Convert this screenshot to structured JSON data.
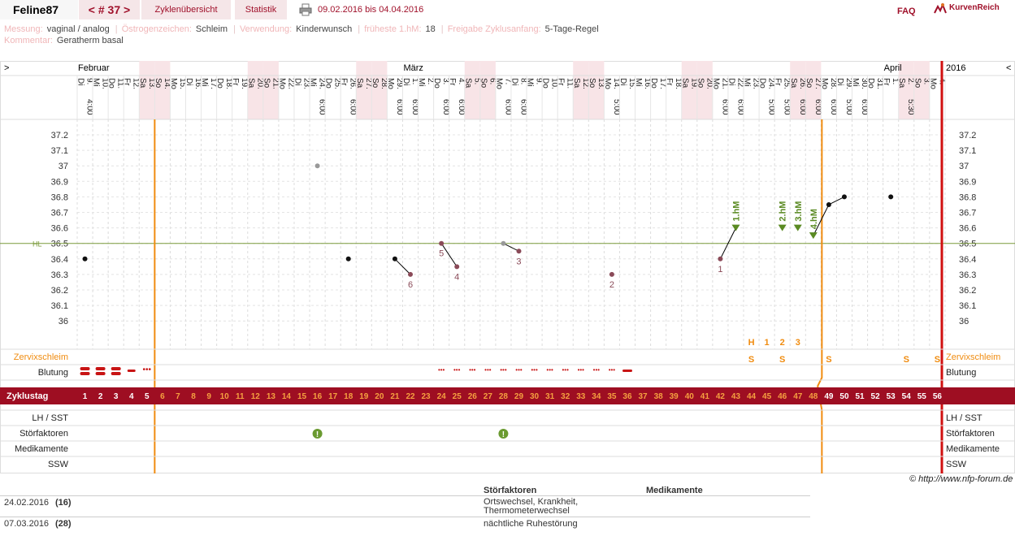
{
  "header": {
    "user": "Feline87",
    "cycle": "< # 37 >",
    "overview": "Zyklenübersicht",
    "stats": "Statistik",
    "range": "09.02.2016 bis 04.04.2016",
    "faq": "FAQ",
    "brand": "KurvenReich"
  },
  "info": {
    "messung_l": "Messung:",
    "messung_v": "vaginal / analog",
    "oestro_l": "Östrogenzeichen:",
    "oestro_v": "Schleim",
    "verw_l": "Verwendung:",
    "verw_v": "Kinderwunsch",
    "hm_l": "früheste 1.hM:",
    "hm_v": "18",
    "frei_l": "Freigabe Zyklusanfang:",
    "frei_v": "5-Tage-Regel",
    "kom_l": "Kommentar:",
    "kom_v": "Geratherm basal"
  },
  "chart": {
    "nav_left": ">",
    "nav_right": "<",
    "year": "2016",
    "months": [
      {
        "name": "Februar",
        "day": 0
      },
      {
        "name": "März",
        "day": 21
      },
      {
        "name": "April",
        "day": 52
      }
    ],
    "days": [
      {
        "d": "9.",
        "w": "Di"
      },
      {
        "d": "10.",
        "w": "Mi"
      },
      {
        "d": "11.",
        "w": "Do"
      },
      {
        "d": "12.",
        "w": "Fr"
      },
      {
        "d": "13.",
        "w": "Sa"
      },
      {
        "d": "14.",
        "w": "So"
      },
      {
        "d": "15.",
        "w": "Mo"
      },
      {
        "d": "16.",
        "w": "Di"
      },
      {
        "d": "17.",
        "w": "Mi"
      },
      {
        "d": "18.",
        "w": "Do"
      },
      {
        "d": "19.",
        "w": "Fr"
      },
      {
        "d": "20.",
        "w": "Sa"
      },
      {
        "d": "21.",
        "w": "So"
      },
      {
        "d": "22.",
        "w": "Mo"
      },
      {
        "d": "23.",
        "w": "Di"
      },
      {
        "d": "24.",
        "w": "Mi"
      },
      {
        "d": "25.",
        "w": "Do"
      },
      {
        "d": "26.",
        "w": "Fr"
      },
      {
        "d": "27.",
        "w": "Sa"
      },
      {
        "d": "28.",
        "w": "So"
      },
      {
        "d": "29.",
        "w": "Mo"
      },
      {
        "d": "1.",
        "w": "Di"
      },
      {
        "d": "2.",
        "w": "Mi"
      },
      {
        "d": "3.",
        "w": "Do"
      },
      {
        "d": "4.",
        "w": "Fr"
      },
      {
        "d": "5.",
        "w": "Sa"
      },
      {
        "d": "6.",
        "w": "So"
      },
      {
        "d": "7.",
        "w": "Mo"
      },
      {
        "d": "8.",
        "w": "Di"
      },
      {
        "d": "9.",
        "w": "Mi"
      },
      {
        "d": "10.",
        "w": "Do"
      },
      {
        "d": "11.",
        "w": "Fr"
      },
      {
        "d": "12.",
        "w": "Sa"
      },
      {
        "d": "13.",
        "w": "So"
      },
      {
        "d": "14.",
        "w": "Mo"
      },
      {
        "d": "15.",
        "w": "Di"
      },
      {
        "d": "16.",
        "w": "Mi"
      },
      {
        "d": "17.",
        "w": "Do"
      },
      {
        "d": "18.",
        "w": "Fr"
      },
      {
        "d": "19.",
        "w": "Sa"
      },
      {
        "d": "20.",
        "w": "So"
      },
      {
        "d": "21.",
        "w": "Mo"
      },
      {
        "d": "22.",
        "w": "Di"
      },
      {
        "d": "23.",
        "w": "Mi"
      },
      {
        "d": "24.",
        "w": "Do"
      },
      {
        "d": "25.",
        "w": "Fr"
      },
      {
        "d": "26.",
        "w": "Sa"
      },
      {
        "d": "27.",
        "w": "So"
      },
      {
        "d": "28.",
        "w": "Mo"
      },
      {
        "d": "29.",
        "w": "Di"
      },
      {
        "d": "30.",
        "w": "Mi"
      },
      {
        "d": "31.",
        "w": "Do"
      },
      {
        "d": "1.",
        "w": "Fr"
      },
      {
        "d": "2.",
        "w": "Sa"
      },
      {
        "d": "3.",
        "w": "So"
      },
      {
        "d": "4.",
        "w": "Mo"
      }
    ],
    "times": {
      "0": "4:00",
      "15": "6:00",
      "17": "6:00",
      "20": "6:00",
      "21": "6:00",
      "23": "6:00",
      "24": "6:00",
      "27": "6:00",
      "28": "6:00",
      "34": "5:00",
      "41": "6:00",
      "42": "6:00",
      "44": "5:00",
      "45": "5:00",
      "46": "6:00",
      "47": "6:00",
      "48": "6:00",
      "49": "5:00",
      "50": "6:00",
      "53": "5:30"
    },
    "y_ticks": [
      "37.2",
      "37.1",
      "37",
      "36.9",
      "36.8",
      "36.7",
      "36.6",
      "36.5",
      "36.4",
      "36.3",
      "36.2",
      "36.1",
      "36"
    ],
    "hl_label": "HL",
    "temps": [
      {
        "day": 0,
        "t": 36.4,
        "c": "black"
      },
      {
        "day": 15,
        "t": 37.0,
        "c": "gray"
      },
      {
        "day": 17,
        "t": 36.4,
        "c": "black"
      },
      {
        "day": 20,
        "t": 36.4,
        "c": "black"
      },
      {
        "day": 21,
        "t": 36.3,
        "c": "maroon",
        "label": "6"
      },
      {
        "day": 23,
        "t": 36.5,
        "c": "maroon",
        "label": "5"
      },
      {
        "day": 24,
        "t": 36.35,
        "c": "maroon",
        "label": "4"
      },
      {
        "day": 27,
        "t": 36.5,
        "c": "gray"
      },
      {
        "day": 28,
        "t": 36.45,
        "c": "maroon",
        "label": "3"
      },
      {
        "day": 34,
        "t": 36.3,
        "c": "maroon",
        "label": "2"
      },
      {
        "day": 41,
        "t": 36.4,
        "c": "maroon",
        "label": "1"
      },
      {
        "day": 42,
        "t": 36.6,
        "c": "green",
        "label": "1.hM"
      },
      {
        "day": 45,
        "t": 36.6,
        "c": "green",
        "label": "2.hM"
      },
      {
        "day": 46,
        "t": 36.6,
        "c": "green",
        "label": "3.hM"
      },
      {
        "day": 47,
        "t": 36.55,
        "c": "green",
        "label": "4.hM"
      },
      {
        "day": 48,
        "t": 36.75,
        "c": "black"
      },
      {
        "day": 49,
        "t": 36.8,
        "c": "black"
      },
      {
        "day": 52,
        "t": 36.8,
        "c": "black"
      }
    ],
    "h_marks": [
      {
        "day": 43,
        "t": "H"
      },
      {
        "day": 44,
        "t": "1"
      },
      {
        "day": 45,
        "t": "2"
      },
      {
        "day": 46,
        "t": "3"
      }
    ],
    "mucus": [
      {
        "day": 43,
        "t": "S"
      },
      {
        "day": 45,
        "t": "S"
      },
      {
        "day": 48,
        "t": "S"
      },
      {
        "day": 53,
        "t": "S"
      },
      {
        "day": 55,
        "t": "S"
      }
    ],
    "rows": {
      "mucus": "Zervixschleim",
      "bleeding": "Blutung",
      "cycleday": "Zyklustag",
      "lh": "LH / SST",
      "stoer": "Störfaktoren",
      "med": "Medikamente",
      "ssw": "SSW"
    },
    "stoer_days": [
      15,
      27
    ],
    "stoer_icon": "exclamation-icon"
  },
  "footer": {
    "copy": "© http://www.nfp-forum.de",
    "head_stoer": "Störfaktoren",
    "head_med": "Medikamente",
    "notes": [
      {
        "date": "24.02.2016",
        "day": "(16)",
        "stoer": "Ortswechsel, Krankheit, Thermometerwechsel"
      },
      {
        "date": "07.03.2016",
        "day": "(28)",
        "stoer": "nächtliche Ruhestörung"
      }
    ]
  }
}
